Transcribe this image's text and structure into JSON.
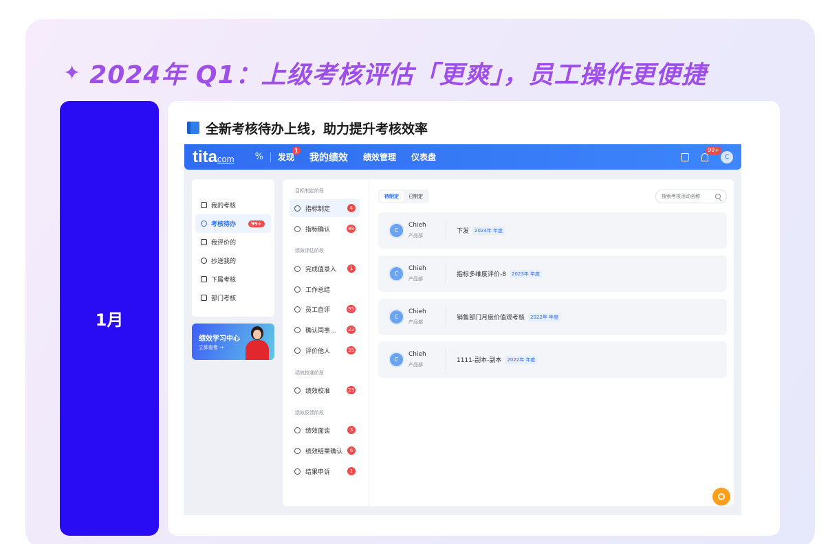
{
  "headline": "2024年 Q1：上级考核评估「更爽」，员工操作更便捷",
  "month": "1月",
  "card_title": "全新考核待办上线，助力提升考核效率",
  "app": {
    "logo_main": "tita",
    "logo_sub": "com",
    "nav_percent": "%",
    "nav": [
      {
        "label": "发现",
        "badge": "1"
      },
      {
        "label": "我的绩效"
      },
      {
        "label": "绩效管理"
      },
      {
        "label": "仪表盘"
      }
    ],
    "bell_badge": "99+",
    "user_initial": "C",
    "left_menu": [
      {
        "label": "我的考核"
      },
      {
        "label": "考核待办",
        "badge": "99+"
      },
      {
        "label": "我评价的"
      },
      {
        "label": "抄送我的"
      },
      {
        "label": "下属考核"
      },
      {
        "label": "部门考核"
      }
    ],
    "promo": {
      "title": "绩效学习中心",
      "link": "立即查看 →"
    },
    "stages": [
      {
        "label": "目标制定阶段",
        "items": [
          {
            "label": "指标制定",
            "count": "4"
          },
          {
            "label": "指标确认",
            "count": "98"
          }
        ]
      },
      {
        "label": "绩效评估阶段",
        "items": [
          {
            "label": "完成值录入",
            "count": "1"
          },
          {
            "label": "工作总结",
            "count": ""
          },
          {
            "label": "员工自评",
            "count": "95"
          },
          {
            "label": "确认同事...",
            "count": "22"
          },
          {
            "label": "评价他人",
            "count": "35"
          }
        ]
      },
      {
        "label": "绩效校准阶段",
        "items": [
          {
            "label": "绩效校准",
            "count": "23"
          }
        ]
      },
      {
        "label": "绩效反馈阶段",
        "items": [
          {
            "label": "绩效面谈",
            "count": "3"
          },
          {
            "label": "绩效结果确认",
            "count": "6"
          },
          {
            "label": "结果申诉",
            "count": "1"
          }
        ]
      }
    ],
    "tabs": [
      "待制定",
      "已制定"
    ],
    "search_placeholder": "搜索考核活动名称",
    "tasks": [
      {
        "initial": "C",
        "name": "Chieh",
        "dept": "产品部",
        "title": "下发",
        "tag": "2024年 年度"
      },
      {
        "initial": "C",
        "name": "Chieh",
        "dept": "产品部",
        "title": "指标多维度评价-8",
        "tag": "2023年 年度"
      },
      {
        "initial": "C",
        "name": "Chieh",
        "dept": "产品部",
        "title": "销售部门月度价值观考核",
        "tag": "2022年 年度"
      },
      {
        "initial": "C",
        "name": "Chieh",
        "dept": "产品部",
        "title": "1111-副本-副本",
        "tag": "2022年 年度"
      }
    ]
  },
  "colors": {
    "accent": "#9d4fe8",
    "month_card": "#2a0cf4",
    "app_blue": "#2f6df0",
    "badge_red": "#f04a4a"
  }
}
